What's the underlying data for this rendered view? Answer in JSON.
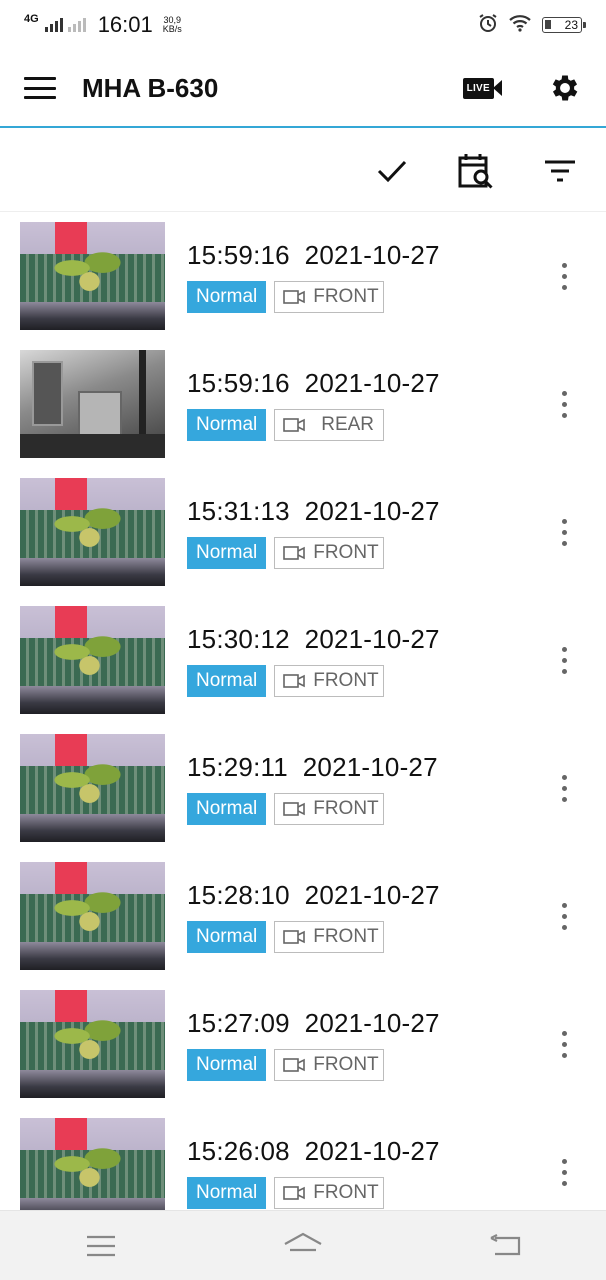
{
  "status_bar": {
    "network": "4G",
    "time": "16:01",
    "speed_value": "30,9",
    "speed_unit": "KB/s",
    "battery": "23"
  },
  "app_bar": {
    "title": "MHA B-630",
    "live_label": "LIVE"
  },
  "recordings": [
    {
      "time": "15:59:16",
      "date": "2021-10-27",
      "event": "Normal",
      "camera": "FRONT",
      "thumb": "front"
    },
    {
      "time": "15:59:16",
      "date": "2021-10-27",
      "event": "Normal",
      "camera": "REAR",
      "thumb": "rear"
    },
    {
      "time": "15:31:13",
      "date": "2021-10-27",
      "event": "Normal",
      "camera": "FRONT",
      "thumb": "front"
    },
    {
      "time": "15:30:12",
      "date": "2021-10-27",
      "event": "Normal",
      "camera": "FRONT",
      "thumb": "front"
    },
    {
      "time": "15:29:11",
      "date": "2021-10-27",
      "event": "Normal",
      "camera": "FRONT",
      "thumb": "front"
    },
    {
      "time": "15:28:10",
      "date": "2021-10-27",
      "event": "Normal",
      "camera": "FRONT",
      "thumb": "front"
    },
    {
      "time": "15:27:09",
      "date": "2021-10-27",
      "event": "Normal",
      "camera": "FRONT",
      "thumb": "front"
    },
    {
      "time": "15:26:08",
      "date": "2021-10-27",
      "event": "Normal",
      "camera": "FRONT",
      "thumb": "front"
    }
  ],
  "colors": {
    "accent": "#35a7dd",
    "divider": "#34a7d6",
    "nav_background": "#f2f2f2"
  },
  "icons": {
    "menu": "hamburger-icon",
    "live": "live-camera-icon",
    "settings": "gear-icon",
    "select": "checkmark-icon",
    "date_search": "calendar-search-icon",
    "filter": "filter-icon",
    "camera": "video-camera-icon",
    "more": "more-vertical-icon"
  }
}
